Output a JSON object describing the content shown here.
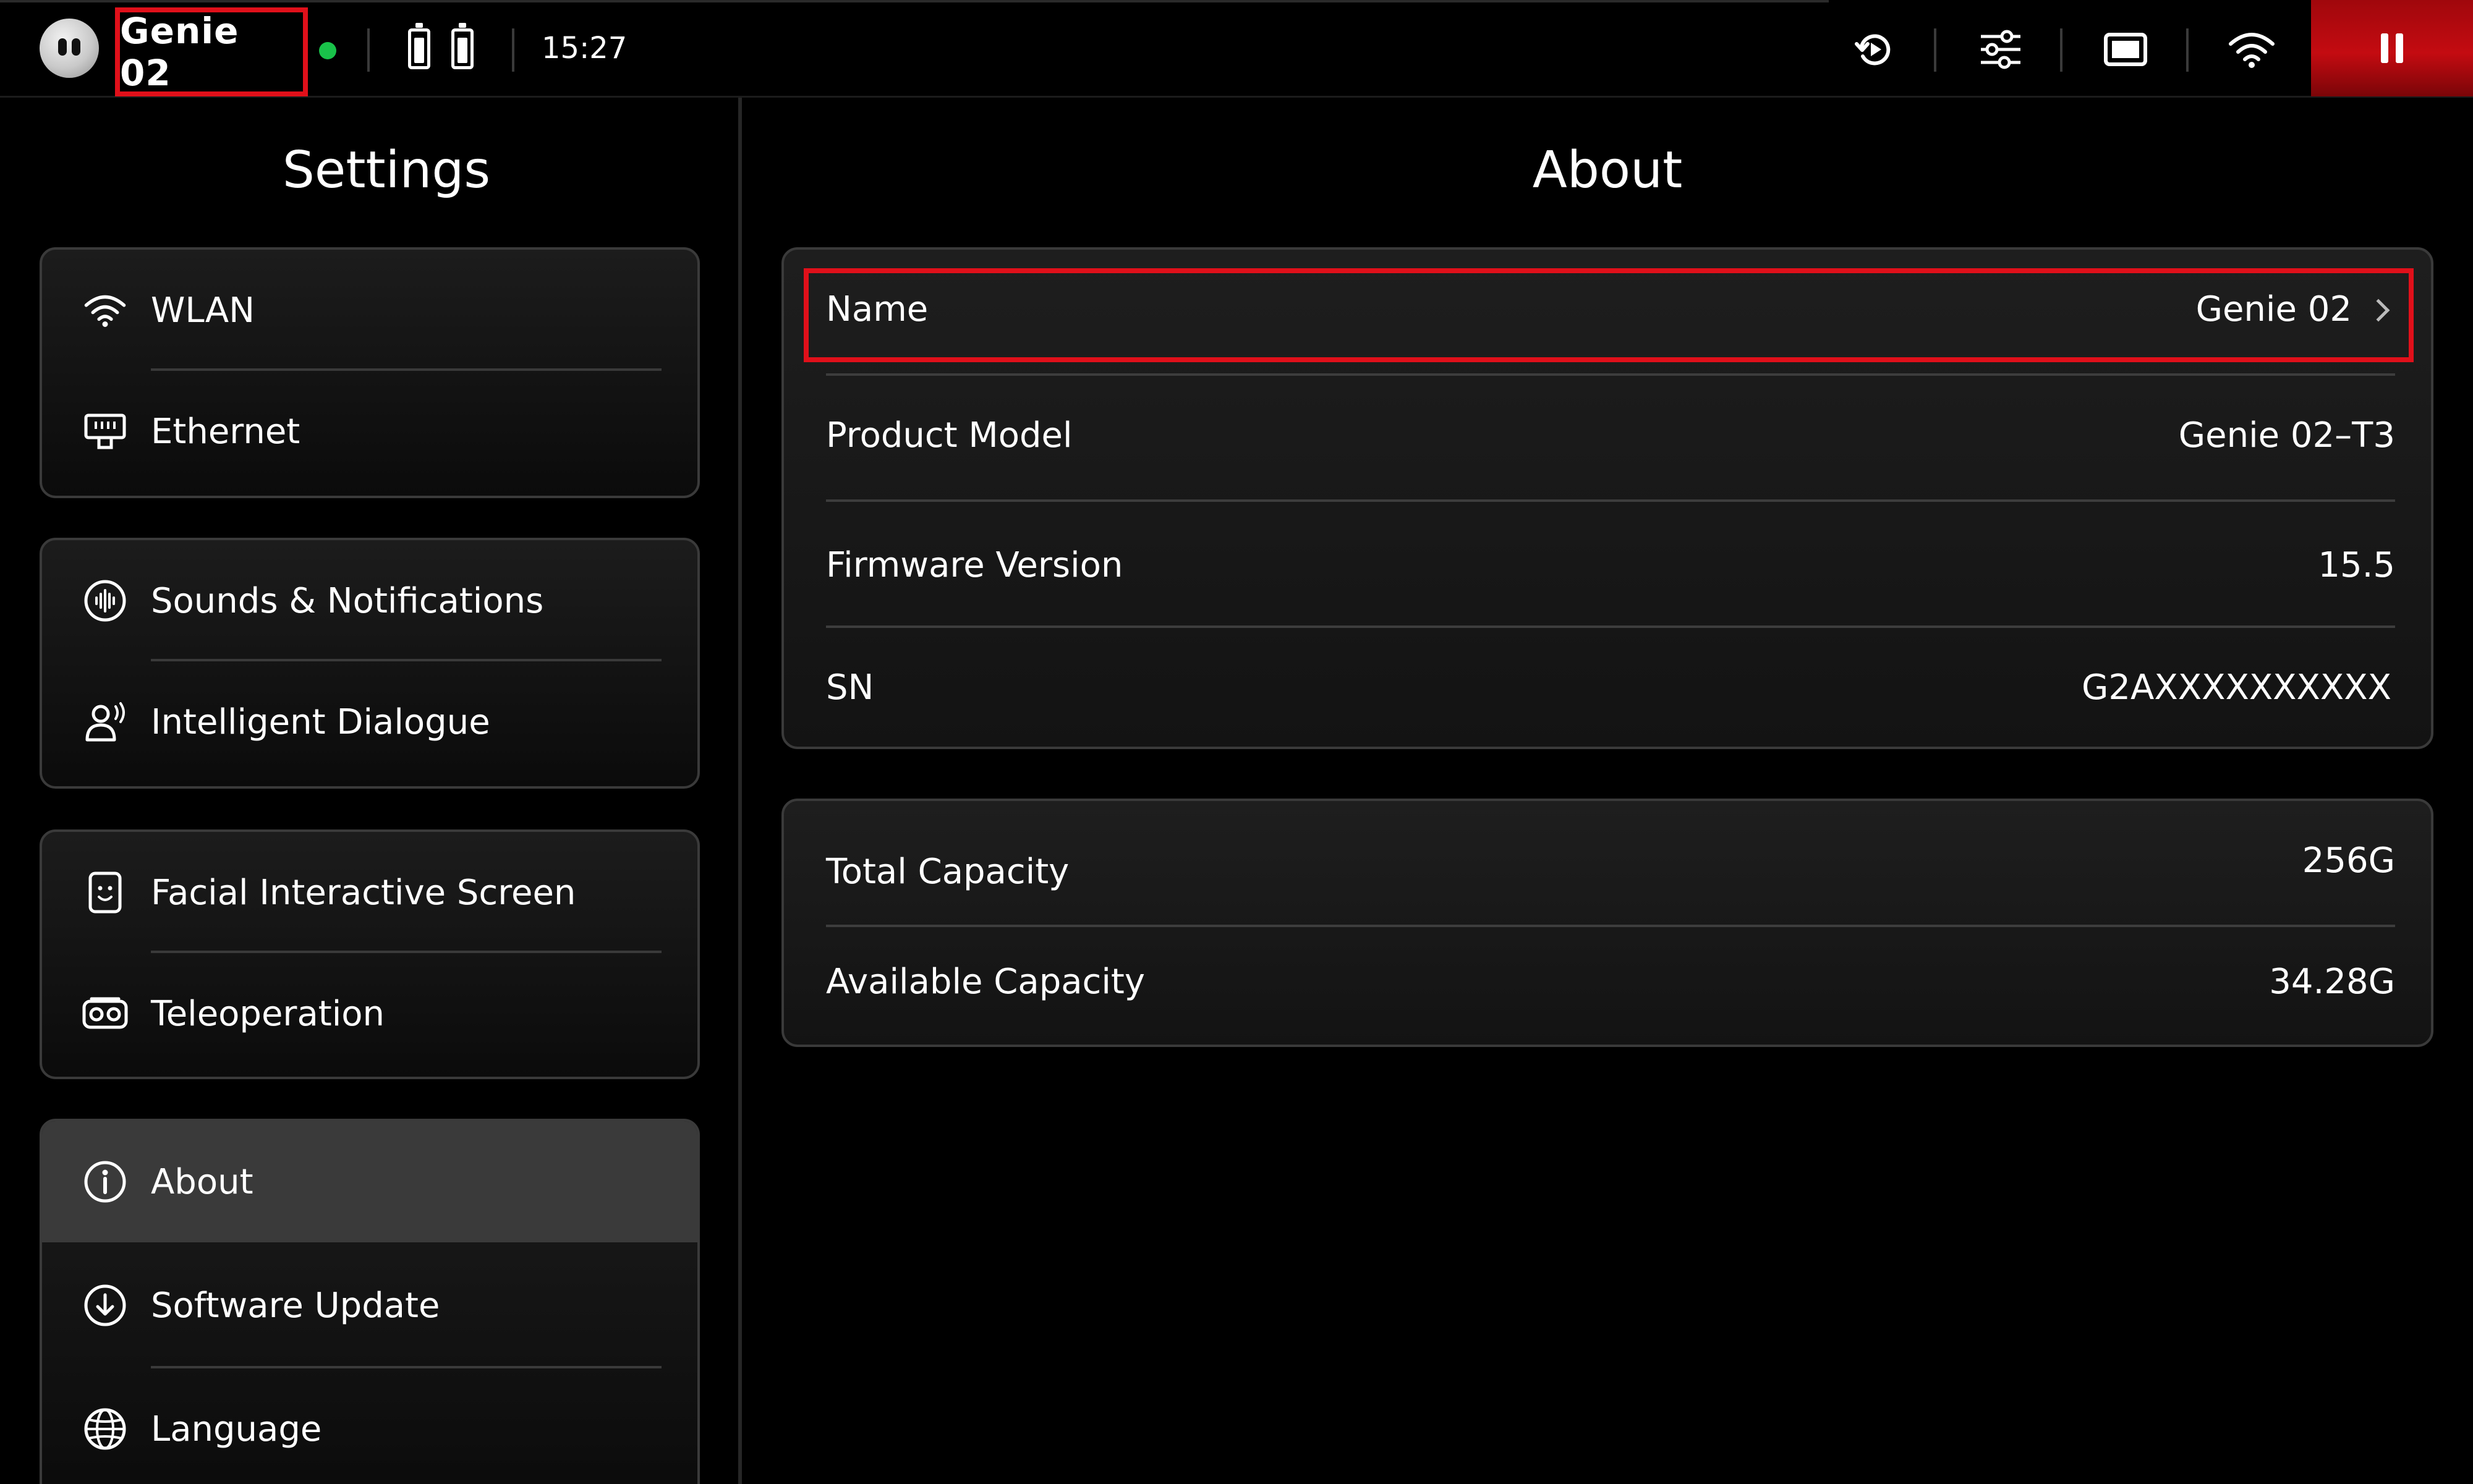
{
  "topbar": {
    "robot_name": "Genie 02",
    "time": "15:27",
    "status_color": "#19c24a",
    "accent_color": "#c40b11",
    "icons": [
      "robot-avatar-icon",
      "battery-icon",
      "battery-icon",
      "replay-icon",
      "sliders-icon",
      "screen-icon",
      "wifi-icon",
      "pause-icon"
    ]
  },
  "sidebar": {
    "title": "Settings",
    "groups": [
      {
        "items": [
          {
            "label": "WLAN",
            "icon": "wifi-icon"
          },
          {
            "label": "Ethernet",
            "icon": "ethernet-icon"
          }
        ]
      },
      {
        "items": [
          {
            "label": "Sounds & Notifications",
            "icon": "sound-wave-icon"
          },
          {
            "label": "Intelligent Dialogue",
            "icon": "person-voice-icon"
          }
        ]
      },
      {
        "items": [
          {
            "label": "Facial Interactive Screen",
            "icon": "face-screen-icon"
          },
          {
            "label": "Teleoperation",
            "icon": "vr-headset-icon"
          }
        ]
      },
      {
        "items": [
          {
            "label": "About",
            "icon": "info-icon",
            "selected": true
          },
          {
            "label": "Software Update",
            "icon": "download-icon"
          },
          {
            "label": "Language",
            "icon": "globe-icon"
          }
        ]
      }
    ]
  },
  "about": {
    "title": "About",
    "device_info": [
      {
        "key": "Name",
        "value": "Genie 02"
      },
      {
        "key": "Product Model",
        "value": "Genie 02–T3"
      },
      {
        "key": "Firmware Version",
        "value": "15.5"
      },
      {
        "key": "SN",
        "value": "G2AXXXXXXXXXX"
      }
    ],
    "storage": [
      {
        "key": "Total Capacity",
        "value": "256G"
      },
      {
        "key": "Available Capacity",
        "value": "34.28G"
      }
    ]
  }
}
